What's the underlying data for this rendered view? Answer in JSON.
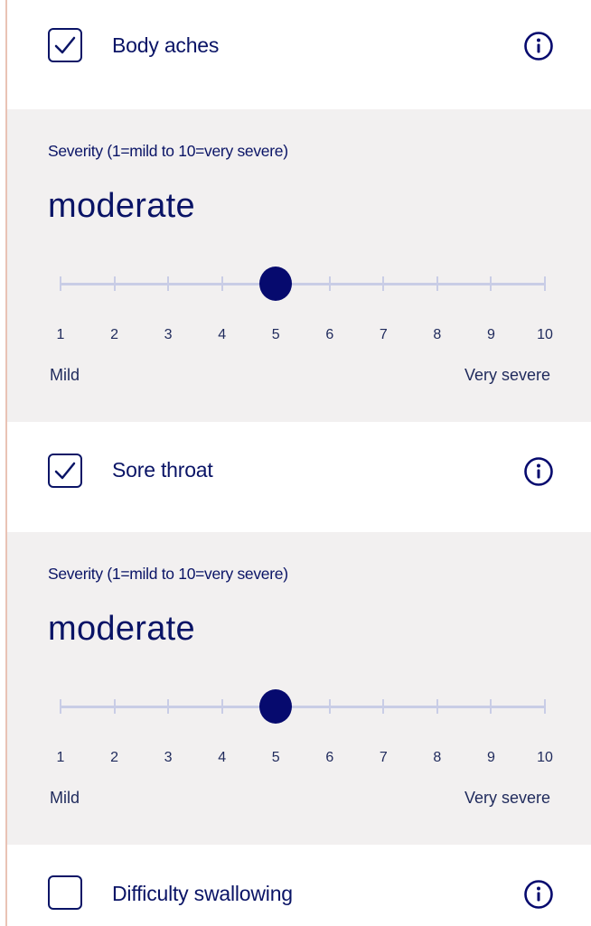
{
  "symptoms": [
    {
      "label": "Body aches",
      "checked": true,
      "info_icon": "info-icon"
    },
    {
      "label": "Sore throat",
      "checked": true,
      "info_icon": "info-icon"
    },
    {
      "label": "Difficulty swallowing",
      "checked": false,
      "info_icon": "info-icon"
    }
  ],
  "severity_panels": [
    {
      "caption": "Severity (1=mild to 10=very severe)",
      "value_text": "moderate",
      "value": 5,
      "min": 1,
      "max": 10,
      "ticks": [
        "1",
        "2",
        "3",
        "4",
        "5",
        "6",
        "7",
        "8",
        "9",
        "10"
      ],
      "min_label": "Mild",
      "max_label": "Very severe"
    },
    {
      "caption": "Severity (1=mild to 10=very severe)",
      "value_text": "moderate",
      "value": 5,
      "min": 1,
      "max": 10,
      "ticks": [
        "1",
        "2",
        "3",
        "4",
        "5",
        "6",
        "7",
        "8",
        "9",
        "10"
      ],
      "min_label": "Mild",
      "max_label": "Very severe"
    }
  ],
  "colors": {
    "accent": "#060a6e",
    "text": "#0a1466",
    "panel_bg": "#f2f0f0",
    "track": "#c9cde6",
    "left_rule": "#e9c3b5"
  }
}
